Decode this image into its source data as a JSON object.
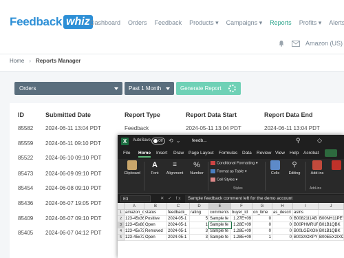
{
  "brand": {
    "name": "Feedback",
    "badge": "whiz"
  },
  "nav": {
    "items": [
      "Dashboard",
      "Orders",
      "Feedback",
      "Products ▾",
      "Campaigns ▾",
      "Reports",
      "Profits ▾",
      "Alerts ▾"
    ],
    "active": "Reports",
    "account": "Amazon (US)"
  },
  "breadcrumb": {
    "home": "Home",
    "current": "Reports Manager"
  },
  "filters": {
    "report_type": "Orders",
    "period": "Past 1 Month",
    "generate_label": "Generate Report"
  },
  "table": {
    "headers": [
      "ID",
      "Submitted Date",
      "Report Type",
      "Report Data Start",
      "Report Data End"
    ],
    "rows": [
      [
        "85582",
        "2024-06-11 13:04 PDT",
        "Feedback",
        "2024-05-11 13:04 PDT",
        "2024-06-11 13:04 PDT"
      ],
      [
        "85559",
        "2024-06-11 09:10 PDT",
        "",
        "",
        ""
      ],
      [
        "85522",
        "2024-06-10 09:10 PDT",
        "",
        "",
        ""
      ],
      [
        "85473",
        "2024-06-09 09:10 PDT",
        "",
        "",
        ""
      ],
      [
        "85454",
        "2024-06-08 09:10 PDT",
        "",
        "",
        ""
      ],
      [
        "85436",
        "2024-06-07 19:05 PDT",
        "",
        "",
        ""
      ],
      [
        "85409",
        "2024-06-07 09:10 PDT",
        "",
        "",
        ""
      ],
      [
        "85405",
        "2024-06-07 04:12 PDT",
        "",
        "",
        ""
      ]
    ]
  },
  "excel": {
    "autosave_label": "AutoSave",
    "toggle_state": "Off",
    "filename": "feedb...",
    "tabs": [
      "File",
      "Home",
      "Insert",
      "Draw",
      "Page Layout",
      "Formulas",
      "Data",
      "Review",
      "View",
      "Help",
      "Acrobat"
    ],
    "active_tab": "Home",
    "ribbon": {
      "clipboard": "Clipboard",
      "font": "Font",
      "alignment": "Alignment",
      "number": "Number",
      "conditional_formatting": "Conditional Formatting ▾",
      "format_as_table": "Format as Table ▾",
      "cell_styles": "Cell Styles ▾",
      "styles_group": "Styles",
      "cells": "Cells",
      "editing": "Editing",
      "addins": "Add-ins",
      "addins_group": "Add-ins"
    },
    "name_box": "E3",
    "formula": "Sample feedback comment left for the demo account",
    "columns": [
      "A",
      "B",
      "C",
      "D",
      "E",
      "F",
      "G",
      "H",
      "I",
      "J"
    ],
    "rows": [
      [
        "amazon_c",
        "status",
        "feedback_",
        "rating",
        "comments",
        "buyer_id",
        "on_time",
        "as_descri",
        "asins",
        ""
      ],
      [
        "123-45x36",
        "Positive",
        "2024-05-1",
        "5",
        "Sample fe",
        "1.27E+09",
        "0",
        "0",
        "B00821I1AB",
        "B00NH11PEY"
      ],
      [
        "123-45x88",
        "Open",
        "2024-05-1",
        "1",
        "Sample fe",
        "1.28E+09",
        "0",
        "0",
        "B00PHMRUFC",
        "B01B1QBK"
      ],
      [
        "123-45x72",
        "Removed",
        "2024-05-1",
        "3",
        "Sample fe",
        "1.28E+09",
        "0",
        "0",
        "B00LGEKOMS",
        "B01B1QBK"
      ],
      [
        "123-45x72",
        "Open",
        "2024-05-1",
        "3",
        "Sample fe",
        "1.28E+09",
        "1",
        "0",
        "B003XOXPY8",
        "B00EEX2IXC"
      ]
    ]
  },
  "colors": {
    "brand": "#2d8fd6",
    "nav_active": "#2ea58c",
    "select_bg": "#5a6e7d",
    "generate_bg": "#6fd1b6",
    "excel_green": "#1d6f42"
  }
}
